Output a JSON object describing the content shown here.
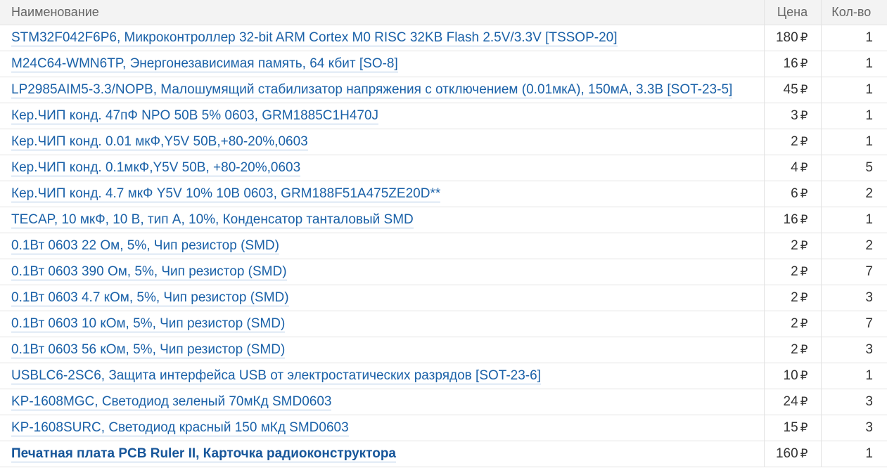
{
  "headers": {
    "name": "Наименование",
    "price": "Цена",
    "qty": "Кол-во"
  },
  "currency_symbol": "₽",
  "rows": [
    {
      "name": "STM32F042F6P6, Микроконтроллер 32-bit ARM Cortex M0 RISC 32KB Flash 2.5V/3.3V [TSSOP-20]",
      "price": "180",
      "qty": "1",
      "bold": false
    },
    {
      "name": "M24C64-WMN6TP, Энергонезависимая память, 64 кбит [SO-8]",
      "price": "16",
      "qty": "1",
      "bold": false
    },
    {
      "name": "LP2985AIM5-3.3/NOPB, Малошумящий стабилизатор напряжения с отключением (0.01мкА), 150мА, 3.3В [SOT-23-5]",
      "price": "45",
      "qty": "1",
      "bold": false
    },
    {
      "name": "Кер.ЧИП конд. 47пФ NPO 50В 5% 0603, GRM1885C1H470J",
      "price": "3",
      "qty": "1",
      "bold": false
    },
    {
      "name": "Кер.ЧИП конд. 0.01 мкФ,Y5V 50В,+80-20%,0603",
      "price": "2",
      "qty": "1",
      "bold": false
    },
    {
      "name": "Кер.ЧИП конд. 0.1мкФ,Y5V 50В, +80-20%,0603",
      "price": "4",
      "qty": "5",
      "bold": false
    },
    {
      "name": "Кер.ЧИП конд. 4.7 мкФ Y5V 10% 10В 0603, GRM188F51A475ZE20D**",
      "price": "6",
      "qty": "2",
      "bold": false
    },
    {
      "name": "TECAP, 10 мкФ, 10 В, тип А, 10%, Конденсатор танталовый SMD",
      "price": "16",
      "qty": "1",
      "bold": false
    },
    {
      "name": "0.1Вт 0603 22 Ом, 5%, Чип резистор (SMD)",
      "price": "2",
      "qty": "2",
      "bold": false
    },
    {
      "name": "0.1Вт 0603 390 Ом, 5%, Чип резистор (SMD)",
      "price": "2",
      "qty": "7",
      "bold": false
    },
    {
      "name": "0.1Вт 0603 4.7 кОм, 5%, Чип резистор (SMD)",
      "price": "2",
      "qty": "3",
      "bold": false
    },
    {
      "name": "0.1Вт 0603 10 кОм, 5%, Чип резистор (SMD)",
      "price": "2",
      "qty": "7",
      "bold": false
    },
    {
      "name": "0.1Вт 0603 56 кОм, 5%, Чип резистор (SMD)",
      "price": "2",
      "qty": "3",
      "bold": false
    },
    {
      "name": "USBLC6-2SC6, Защита интерфейса USB от электростатических разрядов [SOT-23-6]",
      "price": "10",
      "qty": "1",
      "bold": false
    },
    {
      "name": "KP-1608MGC, Светодиод зеленый 70мКд SMD0603",
      "price": "24",
      "qty": "3",
      "bold": false
    },
    {
      "name": "KP-1608SURC, Светодиод красный 150 мКд SMD0603",
      "price": "15",
      "qty": "3",
      "bold": false
    },
    {
      "name": "Печатная плата PCB Ruler II, Карточка радиоконструктора",
      "price": "160",
      "qty": "1",
      "bold": true
    }
  ]
}
